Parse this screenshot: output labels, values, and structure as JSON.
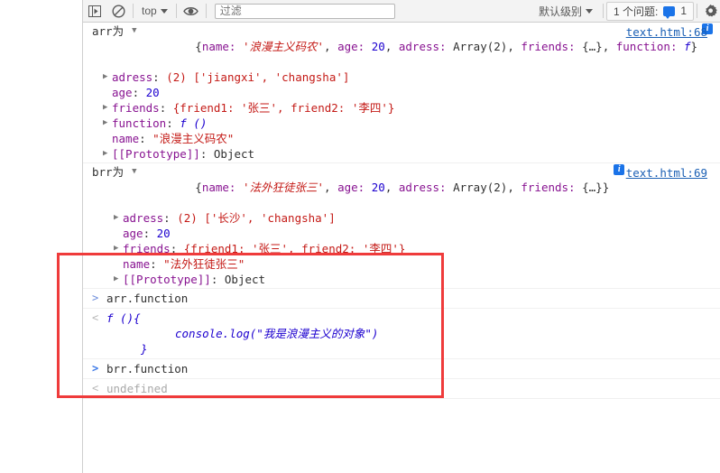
{
  "toolbar": {
    "sidebar_toggle_icon": "console-sidebar-icon",
    "clear_icon": "clear-console-icon",
    "context_selector": "top",
    "eye_icon": "live-expression-eye-icon",
    "filter_placeholder": "过滤",
    "filter_value": "",
    "level_selector": "默认级别",
    "issues_label": "1 个问题:",
    "issues_count": "1",
    "settings_icon": "gear-icon"
  },
  "console": {
    "messages": [
      {
        "label": "arr为",
        "source": "text.html:68",
        "preview_parts": [
          {
            "t": "{",
            "c": "k-plain"
          },
          {
            "t": "name: ",
            "c": "k-name"
          },
          {
            "t": "'浪漫主义码农'",
            "c": "k-str-cn"
          },
          {
            "t": ", ",
            "c": "k-plain"
          },
          {
            "t": "age: ",
            "c": "k-name"
          },
          {
            "t": "20",
            "c": "k-num"
          },
          {
            "t": ", ",
            "c": "k-plain"
          },
          {
            "t": "adress: ",
            "c": "k-name"
          },
          {
            "t": "Array(2)",
            "c": "k-plain"
          },
          {
            "t": ", ",
            "c": "k-plain"
          },
          {
            "t": "friends: ",
            "c": "k-name"
          },
          {
            "t": "{…}",
            "c": "k-plain"
          },
          {
            "t": ", ",
            "c": "k-plain"
          },
          {
            "t": "function: ",
            "c": "k-name"
          },
          {
            "t": "f",
            "c": "k-fn"
          },
          {
            "t": "}",
            "c": "k-plain"
          }
        ],
        "props": [
          {
            "arrow": "right",
            "name": "adress",
            "value": "(2) ['jiangxi', 'changsha']"
          },
          {
            "arrow": "none",
            "name": "age",
            "value": "20"
          },
          {
            "arrow": "right",
            "name": "friends",
            "value": "{friend1: '张三', friend2: '李四'}"
          },
          {
            "arrow": "right",
            "name": "function",
            "value": "f ()"
          },
          {
            "arrow": "none",
            "name": "name",
            "value": "\"浪漫主义码农\""
          },
          {
            "arrow": "right",
            "name": "[[Prototype]]",
            "value": "Object"
          }
        ]
      },
      {
        "label": "brr为",
        "source": "text.html:69",
        "preview_parts": [
          {
            "t": "{",
            "c": "k-plain"
          },
          {
            "t": "name: ",
            "c": "k-name"
          },
          {
            "t": "'法外狂徒张三'",
            "c": "k-str-cn"
          },
          {
            "t": ", ",
            "c": "k-plain"
          },
          {
            "t": "age: ",
            "c": "k-name"
          },
          {
            "t": "20",
            "c": "k-num"
          },
          {
            "t": ", ",
            "c": "k-plain"
          },
          {
            "t": "adress: ",
            "c": "k-name"
          },
          {
            "t": "Array(2)",
            "c": "k-plain"
          },
          {
            "t": ", ",
            "c": "k-plain"
          },
          {
            "t": "friends: ",
            "c": "k-name"
          },
          {
            "t": "{…}",
            "c": "k-plain"
          },
          {
            "t": "}",
            "c": "k-plain"
          }
        ],
        "props": [
          {
            "arrow": "right",
            "name": "adress",
            "value": "(2) ['长沙', 'changsha']"
          },
          {
            "arrow": "none",
            "name": "age",
            "value": "20"
          },
          {
            "arrow": "right",
            "name": "friends",
            "value": "{friend1: '张三', friend2: '李四'}"
          },
          {
            "arrow": "none",
            "name": "name",
            "value": "\"法外狂徒张三\""
          },
          {
            "arrow": "right",
            "name": "[[Prototype]]",
            "value": "Object"
          }
        ]
      }
    ],
    "commands": [
      {
        "input": "arr.function",
        "prompt_style": "gray"
      },
      {
        "input": "brr.function",
        "prompt_style": "blue"
      }
    ],
    "result_function_line1": "f (){",
    "result_function_line2": "console.log(\"我是浪漫主义的对象\")",
    "result_function_line3": "}",
    "result_undefined": "undefined"
  },
  "annotation": {
    "box_color": "#ef3b3b",
    "name": "red-highlight-box"
  }
}
